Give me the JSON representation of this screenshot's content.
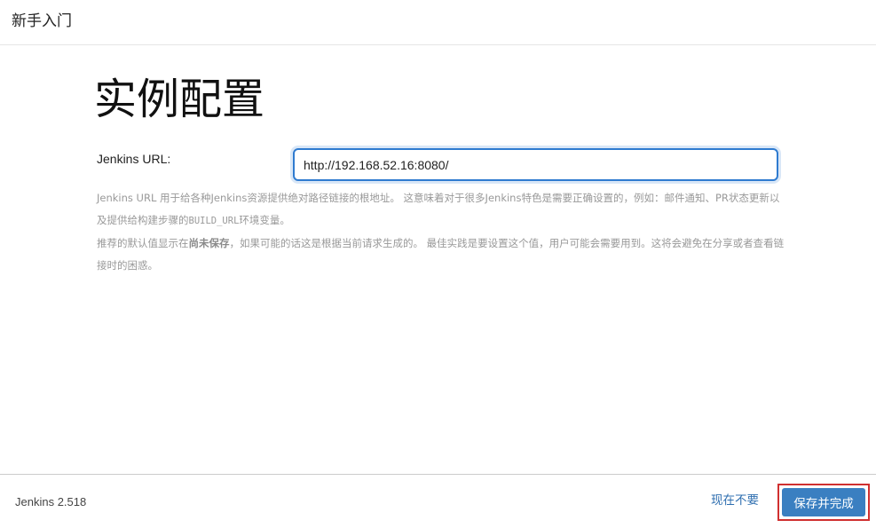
{
  "header": {
    "title": "新手入门"
  },
  "main": {
    "title": "实例配置",
    "field_label": "Jenkins URL:",
    "url_value": "http://192.168.52.16:8080/",
    "help": {
      "p1_a": "Jenkins URL 用于给各种Jenkins资源提供绝对路径链接的根地址。 这意味着对于很多Jenkins特色是需要正确设置的，例如：邮件通知、PR状态更新以及提供给构建步骤的",
      "p1_code": "BUILD_URL",
      "p1_b": "环境变量。",
      "p2_a": "推荐的默认值显示在",
      "p2_bold": "尚未保存",
      "p2_b": "，如果可能的话这是根据当前请求生成的。 最佳实践是要设置这个值，用户可能会需要用到。这将会避免在分享或者查看链接时的困惑。"
    }
  },
  "footer": {
    "version": "Jenkins 2.518",
    "skip_label": "现在不要",
    "save_label": "保存并完成"
  },
  "colors": {
    "accent": "#3a7fc1",
    "link": "#2f6fb0",
    "highlight_border": "#d03030",
    "input_focus": "#2f7bd0"
  }
}
